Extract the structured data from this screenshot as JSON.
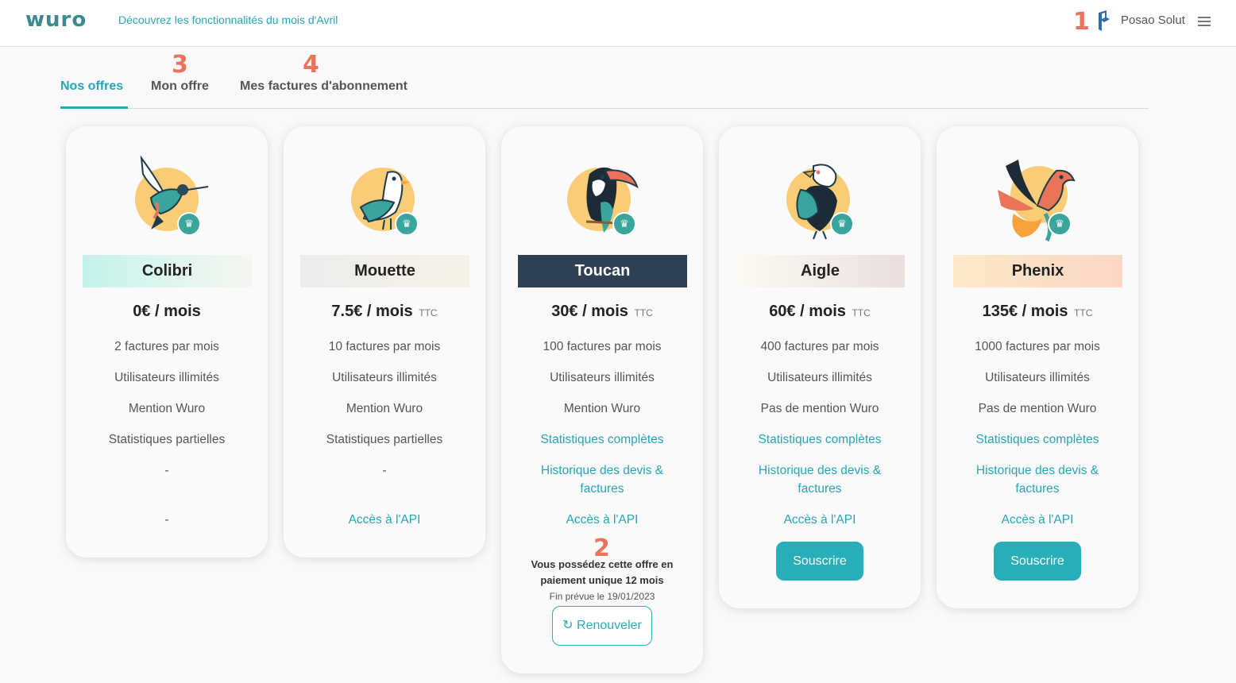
{
  "topbar": {
    "logo": "wuro",
    "news_link": "Découvrez les fonctionnalités du mois d'Avril",
    "company_name": "Posao Solut"
  },
  "markers": {
    "m1": "1",
    "m2": "2",
    "m3": "3",
    "m4": "4"
  },
  "tabs": [
    {
      "label": "Nos offres",
      "active": true
    },
    {
      "label": "Mon offre",
      "active": false
    },
    {
      "label": "Mes factures d'abonnement",
      "active": false
    }
  ],
  "plans": [
    {
      "name": "Colibri",
      "price": "0€ / mois",
      "ttc": "",
      "features": [
        "2 factures par mois",
        "Utilisateurs illimités",
        "Mention Wuro",
        "Statistiques partielles",
        "-",
        "-"
      ]
    },
    {
      "name": "Mouette",
      "price": "7.5€ / mois",
      "ttc": "TTC",
      "features": [
        "10 factures par mois",
        "Utilisateurs illimités",
        "Mention Wuro",
        "Statistiques partielles",
        "-",
        "Accès à l'API"
      ]
    },
    {
      "name": "Toucan",
      "price": "30€ / mois",
      "ttc": "TTC",
      "features": [
        "100 factures par mois",
        "Utilisateurs illimités",
        "Mention Wuro",
        "Statistiques complètes",
        "Historique des devis & factures",
        "Accès à l'API"
      ],
      "owned_note": "Vous possédez cette offre en paiement unique 12 mois",
      "end_date": "Fin prévue le 19/01/2023",
      "renew_label": "Renouveler"
    },
    {
      "name": "Aigle",
      "price": "60€ / mois",
      "ttc": "TTC",
      "features": [
        "400 factures par mois",
        "Utilisateurs illimités",
        "Pas de mention Wuro",
        "Statistiques complètes",
        "Historique des devis & factures",
        "Accès à l'API"
      ],
      "subscribe_label": "Souscrire"
    },
    {
      "name": "Phenix",
      "price": "135€ / mois",
      "ttc": "TTC",
      "features": [
        "1000 factures par mois",
        "Utilisateurs illimités",
        "Pas de mention Wuro",
        "Statistiques complètes",
        "Historique des devis & factures",
        "Accès à l'API"
      ],
      "subscribe_label": "Souscrire"
    }
  ],
  "icons": {
    "plan_badge": "crown-icon",
    "renew": "refresh-icon",
    "menu": "hamburger-menu-icon",
    "company": "company-logo-icon"
  },
  "colors": {
    "accent": "#26a6b6",
    "marker": "#e9745a",
    "toucan_header": "#2e4052",
    "subscribe_button": "#27aeb8"
  }
}
